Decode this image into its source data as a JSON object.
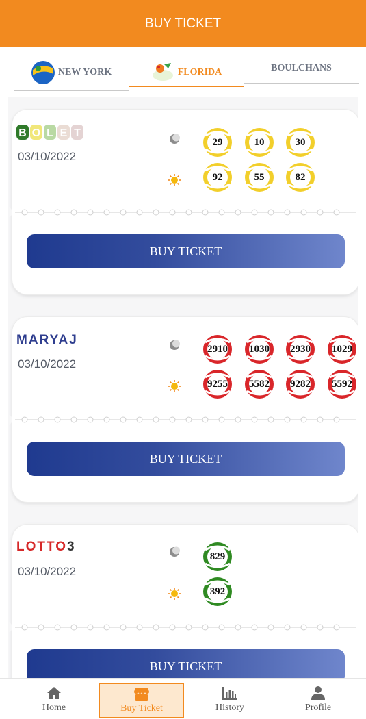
{
  "header": {
    "title": "BUY TICKET"
  },
  "tabs": [
    {
      "label": "NEW YORK",
      "logo_text": "NEW YORK LOTTERY",
      "active": false
    },
    {
      "label": "FLORIDA",
      "logo_text": "Lottery",
      "active": true
    },
    {
      "label": "BOULCHANS",
      "active": false
    }
  ],
  "games": [
    {
      "logo_letters": [
        "B",
        "O",
        "L",
        "E",
        "T"
      ],
      "date": "03/10/2022",
      "ball_color": "yellow",
      "moon_numbers": [
        "29",
        "10",
        "30"
      ],
      "sun_numbers": [
        "92",
        "55",
        "82"
      ],
      "button_label": "BUY TICKET"
    },
    {
      "logo_text": "MARYAJ",
      "date": "03/10/2022",
      "ball_color": "red",
      "moon_numbers": [
        "2910",
        "1030",
        "2930",
        "1029"
      ],
      "sun_numbers": [
        "9255",
        "5582",
        "9282",
        "5592"
      ],
      "button_label": "BUY TICKET"
    },
    {
      "logo_text_red": "LOTTO",
      "logo_text_dark": "3",
      "date": "03/10/2022",
      "ball_color": "green",
      "moon_numbers": [
        "829"
      ],
      "sun_numbers": [
        "392"
      ],
      "button_label": "BUY TICKET"
    }
  ],
  "bottom_nav": [
    {
      "label": "Home",
      "icon": "home-icon",
      "active": false
    },
    {
      "label": "Buy Ticket",
      "icon": "store-icon",
      "active": true
    },
    {
      "label": "History",
      "icon": "bar-chart-icon",
      "active": false
    },
    {
      "label": "Profile",
      "icon": "user-icon",
      "active": false
    }
  ],
  "colors": {
    "accent": "#f28a1f",
    "button_start": "#1f3a8f",
    "button_end": "#6f86cc",
    "ball_yellow": "#f2cf2b",
    "ball_red": "#d9262a",
    "ball_green": "#2f8a22"
  }
}
